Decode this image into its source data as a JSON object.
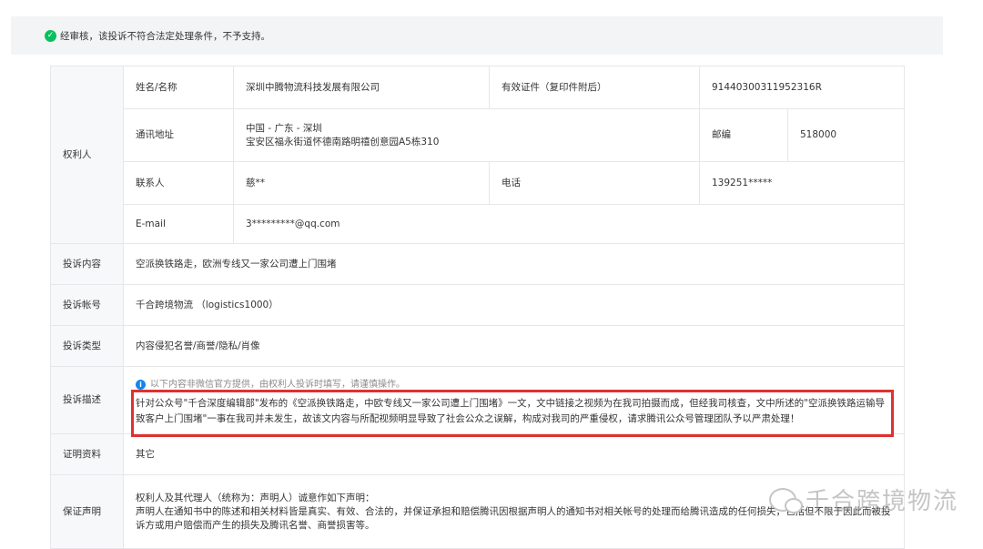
{
  "notice": {
    "message": "经审核，该投诉不符合法定处理条件，不予支持。"
  },
  "rights_holder": {
    "section_label": "权利人",
    "name_label": "姓名/名称",
    "name_value": "深圳中腾物流科技发展有限公司",
    "id_label": "有效证件（复印件附后）",
    "id_value": "91440300311952316R",
    "address_label": "通讯地址",
    "address_line1": "中国 - 广东 - 深圳",
    "address_line2": "宝安区福永街道怀德南路明禧创意园A5栋310",
    "postcode_label": "邮编",
    "postcode_value": "518000",
    "contact_label": "联系人",
    "contact_value": "慈**",
    "phone_label": "电话",
    "phone_value": "139251*****",
    "email_label": "E-mail",
    "email_value": "3*********@qq.com"
  },
  "complaint_content": {
    "label": "投诉内容",
    "value": "空派换铁路走，欧洲专线又一家公司遭上门围堵"
  },
  "complaint_account": {
    "label": "投诉帐号",
    "value": "千合跨境物流 （logistics1000）"
  },
  "complaint_type": {
    "label": "投诉类型",
    "value": "内容侵犯名誉/商誉/隐私/肖像"
  },
  "complaint_desc": {
    "label": "投诉描述",
    "tip": "以下内容非微信官方提供，由权利人投诉时填写，请谨慎操作。",
    "text": "针对公众号\"千合深度编辑部\"发布的《空派换铁路走，中欧专线又一家公司遭上门围堵》一文，文中链接之视频为在我司拍摄而成，但经我司核查，文中所述的\"空派换铁路运输导致客户上门围堵\"一事在我司并未发生，故该文内容与所配视频明显导致了社会公众之误解，构成对我司的严重侵权，请求腾讯公众号管理团队予以严肃处理！"
  },
  "proof": {
    "label": "证明资料",
    "value": "其它"
  },
  "declaration": {
    "label": "保证声明",
    "line1": "权利人及其代理人（统称为：声明人）诚意作如下声明：",
    "line2": "声明人在通知书中的陈述和相关材料皆是真实、有效、合法的，并保证承担和赔偿腾讯因根据声明人的通知书对相关帐号的处理而给腾讯造成的任何损失，包括但不限于因此而被投",
    "line3": "诉方或用户赔偿而产生的损失及腾讯名誉、商誉损害等。"
  },
  "watermark": {
    "text": "千合跨境物流",
    "icon": "wechat-icon"
  },
  "colors": {
    "highlight_border": "#e03030",
    "success": "#07c160",
    "info": "#1485ee"
  }
}
